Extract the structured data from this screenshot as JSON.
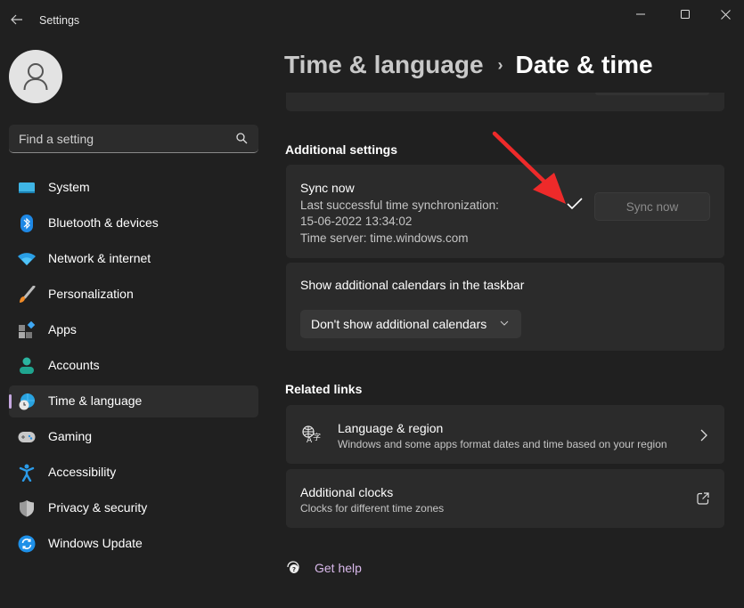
{
  "window": {
    "app_title": "Settings",
    "controls": {
      "minimize": "minimize-icon",
      "maximize": "maximize-icon",
      "close": "close-icon"
    }
  },
  "sidebar": {
    "search": {
      "placeholder": "Find a setting",
      "icon": "search-icon"
    },
    "items": [
      {
        "label": "System",
        "icon": "system-icon",
        "active": false
      },
      {
        "label": "Bluetooth & devices",
        "icon": "bluetooth-icon",
        "active": false
      },
      {
        "label": "Network & internet",
        "icon": "wifi-icon",
        "active": false
      },
      {
        "label": "Personalization",
        "icon": "paintbrush-icon",
        "active": false
      },
      {
        "label": "Apps",
        "icon": "apps-icon",
        "active": false
      },
      {
        "label": "Accounts",
        "icon": "accounts-icon",
        "active": false
      },
      {
        "label": "Time & language",
        "icon": "time-language-icon",
        "active": true
      },
      {
        "label": "Gaming",
        "icon": "gamepad-icon",
        "active": false
      },
      {
        "label": "Accessibility",
        "icon": "accessibility-icon",
        "active": false
      },
      {
        "label": "Privacy & security",
        "icon": "shield-icon",
        "active": false
      },
      {
        "label": "Windows Update",
        "icon": "windows-update-icon",
        "active": false
      }
    ]
  },
  "header": {
    "breadcrumb_parent": "Time & language",
    "breadcrumb_separator": "›",
    "breadcrumb_current": "Date & time"
  },
  "additional_settings": {
    "title": "Additional settings",
    "sync": {
      "title": "Sync now",
      "last_sync_label": "Last successful time synchronization:",
      "last_sync_value": "15-06-2022 13:34:02",
      "time_server": "Time server: time.windows.com",
      "button_label": "Sync now",
      "status_icon": "check-icon"
    },
    "calendars": {
      "title": "Show additional calendars in the taskbar",
      "selected": "Don't show additional calendars"
    }
  },
  "related_links": {
    "title": "Related links",
    "items": [
      {
        "title": "Language & region",
        "subtitle": "Windows and some apps format dates and time based on your region",
        "icon": "language-region-icon",
        "action_icon": "chevron-right-icon"
      },
      {
        "title": "Additional clocks",
        "subtitle": "Clocks for different time zones",
        "action_icon": "external-link-icon"
      }
    ]
  },
  "footer": {
    "get_help": "Get help"
  },
  "colors": {
    "background": "#202020",
    "card": "#2b2b2b",
    "accent": "#c6a8e0",
    "annotation_arrow": "#ee2a2a"
  }
}
